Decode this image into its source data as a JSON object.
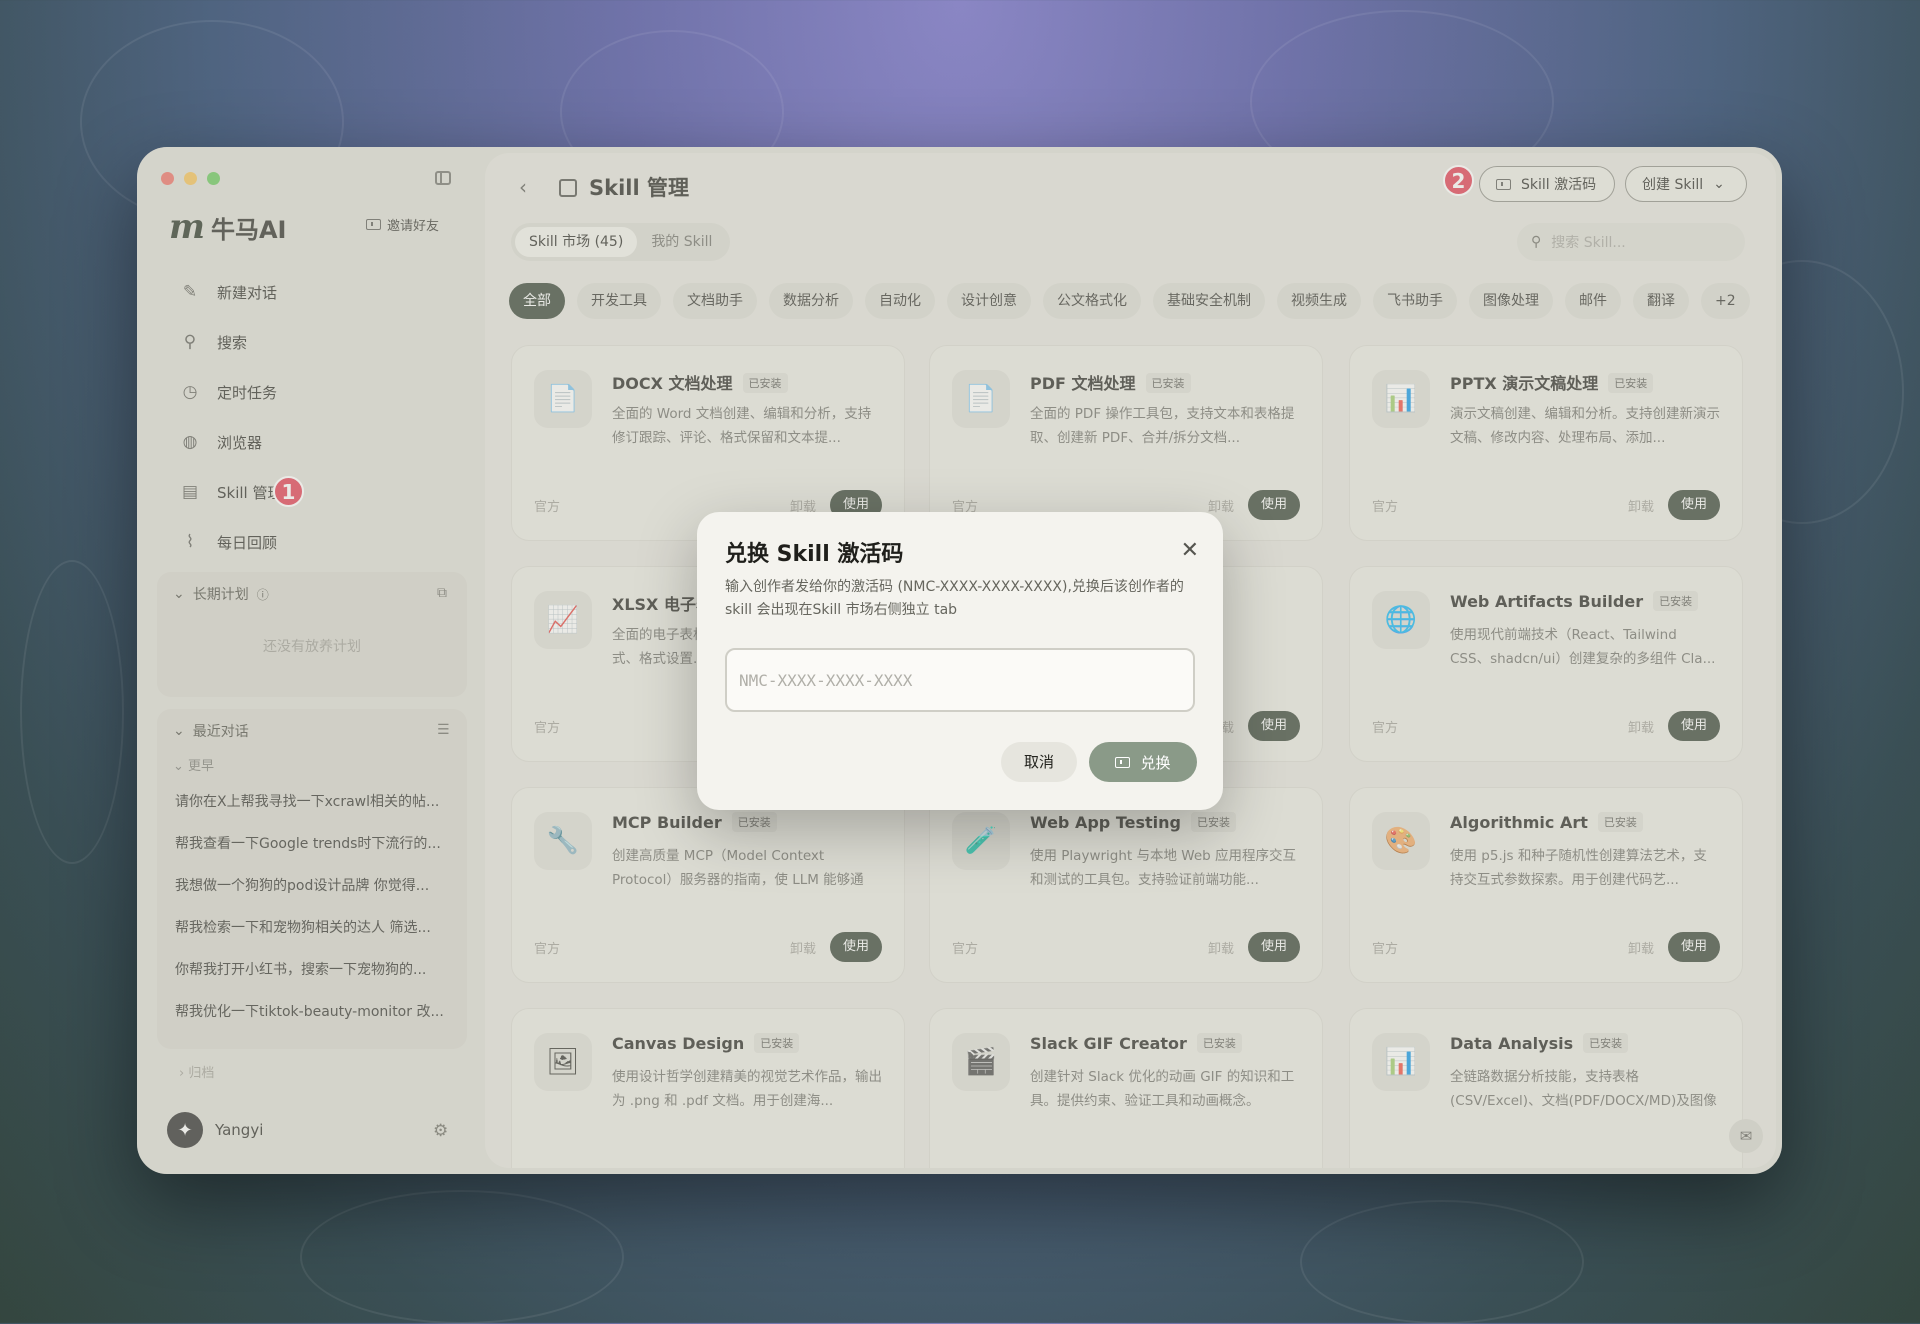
{
  "sidebar": {
    "brand_logo": "m",
    "brand_name": "牛马AI",
    "invite_label": "邀请好友",
    "nav": [
      {
        "label": "新建对话",
        "icon": "new-chat-icon",
        "glyph": "✎"
      },
      {
        "label": "搜索",
        "icon": "search-icon",
        "glyph": "⚲"
      },
      {
        "label": "定时任务",
        "icon": "clock-icon",
        "glyph": "◷"
      },
      {
        "label": "浏览器",
        "icon": "globe-icon",
        "glyph": "◍"
      },
      {
        "label": "Skill 管理",
        "icon": "skill-icon",
        "glyph": "▤",
        "badge": "1"
      },
      {
        "label": "每日回顾",
        "icon": "chart-icon",
        "glyph": "⌇"
      }
    ],
    "plans": {
      "title": "长期计划",
      "empty": "还没有放养计划"
    },
    "recent": {
      "title": "最近对话",
      "group": "更早",
      "items": [
        "请你在X上帮我寻找一下xcrawl相关的帖...",
        "帮我查看一下Google trends时下流行的...",
        "我想做一个狗狗的pod设计品牌 你觉得...",
        "帮我检索一下和宠物狗相关的达人 筛选...",
        "你帮我打开小红书，搜索一下宠物狗的...",
        "帮我优化一下tiktok-beauty-monitor 改..."
      ]
    },
    "archive": "归档",
    "user_name": "Yangyi"
  },
  "header": {
    "back": "‹",
    "title": "Skill 管理",
    "badge": "2",
    "activate_label": "Skill 激活码",
    "create_label": "创建 Skill"
  },
  "tabs": [
    "Skill 市场 (45)",
    "我的 Skill"
  ],
  "search_placeholder": "搜索 Skill...",
  "chips": [
    "全部",
    "开发工具",
    "文档助手",
    "数据分析",
    "自动化",
    "设计创意",
    "公文格式化",
    "基础安全机制",
    "视频生成",
    "飞书助手",
    "图像处理",
    "邮件",
    "翻译",
    "+2"
  ],
  "card_labels": {
    "installed": "已安装",
    "official": "官方",
    "uninstall": "卸载",
    "use": "使用"
  },
  "cards": [
    {
      "title": "DOCX 文档处理",
      "icon": "docx-icon",
      "glyph": "📄",
      "desc": "全面的 Word 文档创建、编辑和分析，支持修订跟踪、评论、格式保留和文本提..."
    },
    {
      "title": "PDF 文档处理",
      "icon": "pdf-icon",
      "glyph": "📄",
      "desc": "全面的 PDF 操作工具包，支持文本和表格提取、创建新 PDF、合并/拆分文档..."
    },
    {
      "title": "PPTX 演示文稿处理",
      "icon": "pptx-icon",
      "glyph": "📊",
      "desc": "演示文稿创建、编辑和分析。支持创建新演示文稿、修改内容、处理布局、添加..."
    },
    {
      "title": "XLSX 电子表",
      "icon": "xlsx-icon",
      "glyph": "📈",
      "desc": "全面的电子表格创建、编辑和分析，支持公式、格式设置..."
    },
    {
      "title": "",
      "icon": "hidden-card-icon",
      "glyph": "",
      "desc": "面，具有高件、页面..."
    },
    {
      "title": "Web Artifacts Builder",
      "icon": "globe-icon",
      "glyph": "🌐",
      "desc": "使用现代前端技术（React、Tailwind CSS、shadcn/ui）创建复杂的多组件 Cla..."
    },
    {
      "title": "MCP Builder",
      "icon": "wrench-icon",
      "glyph": "🔧",
      "desc": "创建高质量 MCP（Model Context Protocol）服务器的指南，使 LLM 能够通过..."
    },
    {
      "title": "Web App Testing",
      "icon": "test-tube-icon",
      "glyph": "🧪",
      "desc": "使用 Playwright 与本地 Web 应用程序交互和测试的工具包。支持验证前端功能..."
    },
    {
      "title": "Algorithmic Art",
      "icon": "palette-icon",
      "glyph": "🎨",
      "desc": "使用 p5.js 和种子随机性创建算法艺术，支持交互式参数探索。用于创建代码艺..."
    },
    {
      "title": "Canvas Design",
      "icon": "picture-icon",
      "glyph": "🖼",
      "desc": "使用设计哲学创建精美的视觉艺术作品，输出为 .png 和 .pdf 文档。用于创建海..."
    },
    {
      "title": "Slack GIF Creator",
      "icon": "clapper-icon",
      "glyph": "🎬",
      "desc": "创建针对 Slack 优化的动画 GIF 的知识和工具。提供约束、验证工具和动画概念。"
    },
    {
      "title": "Data Analysis",
      "icon": "bar-chart-icon",
      "glyph": "📊",
      "desc": "全链路数据分析技能，支持表格(CSV/Excel)、文档(PDF/DOCX/MD)及图像数..."
    }
  ],
  "modal": {
    "title": "兑换 Skill 激活码",
    "desc": "输入创作者发给你的激活码 (NMC-XXXX-XXXX-XXXX),兑换后该创作者的 skill 会出现在Skill 市场右侧独立 tab",
    "input_value": "",
    "input_placeholder": "NMC-XXXX-XXXX-XXXX",
    "cancel_label": "取消",
    "redeem_label": "兑换"
  }
}
